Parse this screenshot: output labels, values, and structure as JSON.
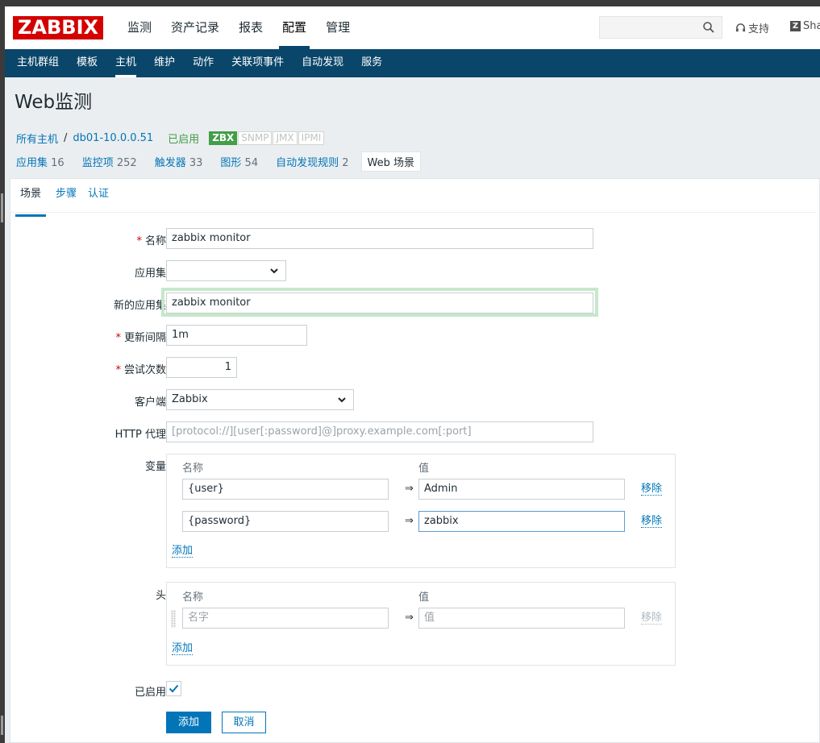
{
  "topnav": {
    "logo": "ZABBIX",
    "menu": [
      "监测",
      "资产记录",
      "报表",
      "配置",
      "管理"
    ],
    "selected": "配置",
    "support": "支持",
    "share": "Sha"
  },
  "subnav": {
    "items": [
      "主机群组",
      "模板",
      "主机",
      "维护",
      "动作",
      "关联项事件",
      "自动发现",
      "服务"
    ],
    "selected": "主机"
  },
  "page": {
    "title": "Web监测"
  },
  "breadcrumb": {
    "all_hosts": "所有主机",
    "separator": "/",
    "host": "db01-10.0.0.51",
    "status": "已启用",
    "badges": [
      "ZBX",
      "SNMP",
      "JMX",
      "IPMI"
    ]
  },
  "host_tabs": [
    {
      "label": "应用集",
      "count": "16"
    },
    {
      "label": "监控项",
      "count": "252"
    },
    {
      "label": "触发器",
      "count": "33"
    },
    {
      "label": "图形",
      "count": "54"
    },
    {
      "label": "自动发现规则",
      "count": "2"
    },
    {
      "label": "Web 场景",
      "count": ""
    }
  ],
  "form_tabs": [
    "场景",
    "步骤",
    "认证"
  ],
  "form": {
    "name_label": "名称",
    "name_value": "zabbix monitor",
    "app_label": "应用集",
    "app_value": "",
    "new_app_label": "新的应用集",
    "new_app_value": "zabbix monitor",
    "interval_label": "更新间隔",
    "interval_value": "1m",
    "attempts_label": "尝试次数",
    "attempts_value": "1",
    "agent_label": "客户端",
    "agent_value": "Zabbix",
    "proxy_label": "HTTP 代理",
    "proxy_placeholder": "[protocol://][user[:password]@]proxy.example.com[:port]",
    "variables_label": "变量",
    "col_name": "名称",
    "col_value": "值",
    "arrow": "⇒",
    "variables": [
      {
        "name": "{user}",
        "value": "Admin"
      },
      {
        "name": "{password}",
        "value": "zabbix"
      }
    ],
    "remove": "移除",
    "add": "添加",
    "headers_label": "头",
    "header_name_placeholder": "名字",
    "header_value_placeholder": "值",
    "enabled_label": "已启用",
    "enabled": true,
    "submit": "添加",
    "cancel": "取消"
  },
  "colors": {
    "accent": "#0275b8",
    "nav": "#0a466a",
    "logo": "#d40000",
    "enabled": "#429e47"
  }
}
